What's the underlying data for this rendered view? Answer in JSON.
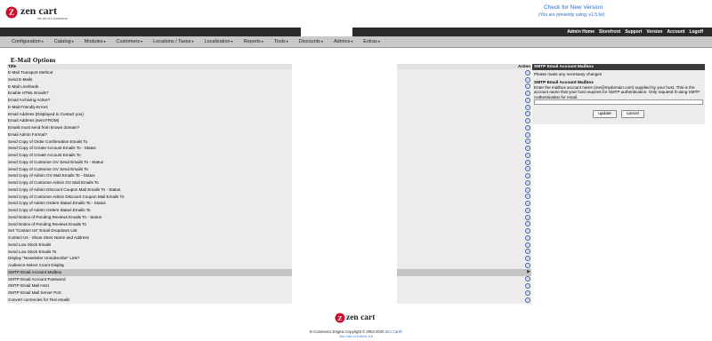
{
  "header": {
    "logo_text": "zen cart",
    "logo_tagline": "the art of e-commerce",
    "check_version": "Check for New Version",
    "presently_using": "(You are presently using: v1.5.6e)",
    "top_links": [
      "Admin Home",
      "Storefront",
      "Support",
      "Version",
      "Account",
      "Logoff"
    ]
  },
  "menu": [
    "Configuration",
    "Catalog",
    "Modules",
    "Customers",
    "Locations / Taxes",
    "Localization",
    "Reports",
    "Tools",
    "Discounts",
    "Admins",
    "Extras"
  ],
  "page_title": "E-Mail Options",
  "table": {
    "header_title": "Title",
    "header_action": "Action",
    "rows": [
      "E-Mail Transport Method",
      "Send E-Mails",
      "E-Mail Linefeeds",
      "Enable HTML Emails?",
      "Email Archiving Active?",
      "E-Mail Friendly-Errors",
      "Email Address (Displayed to Contact you)",
      "Email Address (sent FROM)",
      "Emails must send from known domain?",
      "Email Admin Format?",
      "Send Copy of Order Confirmation Emails To",
      "Send Copy of Create Account Emails To - Status",
      "Send Copy of Create Account Emails To",
      "Send Copy of Customer GV Send Emails To - Status",
      "Send Copy of Customer GV Send Emails To",
      "Send Copy of Admin GV Mail Emails To - Status",
      "Send Copy of Customer Admin GV Mail Emails To",
      "Send Copy of Admin Discount Coupon Mail Emails To - Status",
      "Send Copy of Customer Admin Discount Coupon Mail Emails To",
      "Send Copy of Admin Orders Status Emails To - Status",
      "Send Copy of Admin Orders Status Emails To",
      "Send Notice of Pending Reviews Emails To - Status",
      "Send Notice of Pending Reviews Emails To",
      "Set \"Contact Us\" Email Dropdown List",
      "Contact Us - Show Store Name and Address",
      "Send Low Stock Emails",
      "Send Low Stock Emails To",
      "Display \"Newsletter Unsubscribe\" Link?",
      "Audience-Select Count Display",
      "SMTP Email Account Mailbox",
      "SMTP Email Account Password",
      "SMTP Email Mail Host",
      "SMTP Email Mail Server Port",
      "Convert currencies for Text emails"
    ],
    "selected_index": 29
  },
  "edit_panel": {
    "title": "SMTP Email Account Mailbox",
    "hint": "Please make any necessary changes",
    "field_name": "SMTP Email Account Mailbox",
    "description": "Enter the mailbox account name (me@mydomain.com) supplied by your host. This is the account name that your host requires for SMTP authentication. Only required if using SMTP Authentication for email.",
    "input_value": "",
    "update_label": "update",
    "cancel_label": "cancel"
  },
  "footer": {
    "copyright_prefix": "E-Commerce Engine Copyright © 2003-2020",
    "copyright_link": "Zen Cart®",
    "version": "Zen Cart v1.5.6e/v1.5.6"
  },
  "colors": {
    "nav_dark": "#2b2b2b",
    "menu_bg": "#c9c9c9",
    "link_blue": "#2a6ebb",
    "logo_red": "#c8102e"
  }
}
